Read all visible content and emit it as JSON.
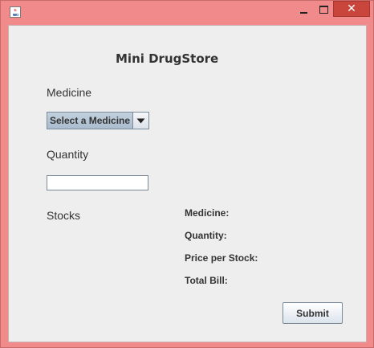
{
  "window": {
    "title": "",
    "icon": "java-coffee-icon",
    "minimize_glyph": "",
    "maximize_glyph": "",
    "close_glyph": "✕",
    "frame_color": "#f18b8b",
    "close_color": "#c9463d"
  },
  "app": {
    "title": "Mini DrugStore"
  },
  "form": {
    "medicine_label": "Medicine",
    "medicine_select_value": "Select a Medicine",
    "quantity_label": "Quantity",
    "quantity_value": "",
    "stocks_label": "Stocks"
  },
  "summary": {
    "medicine": "Medicine:",
    "quantity": "Quantity:",
    "price_per_stock": "Price per Stock:",
    "total_bill": "Total Bill:"
  },
  "actions": {
    "submit_label": "Submit"
  }
}
